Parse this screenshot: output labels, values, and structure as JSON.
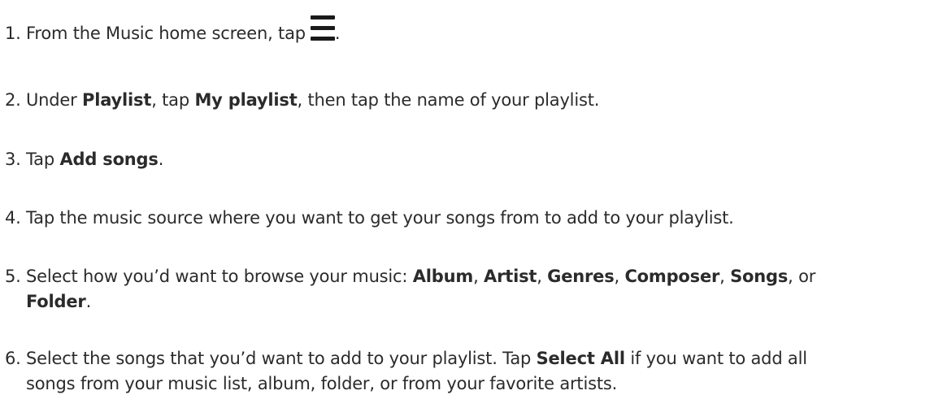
{
  "steps": [
    {
      "num": "1.",
      "text_before": "From the Music home screen, tap",
      "icon": "menu-icon",
      "text_after": "."
    },
    {
      "num": "2.",
      "t1": "Under ",
      "b1": "Playlist",
      "t2": ", tap ",
      "b2": "My playlist",
      "t3": ", then tap the name of your playlist."
    },
    {
      "num": "3.",
      "t1": "Tap ",
      "b1": "Add songs",
      "t2": "."
    },
    {
      "num": "4.",
      "t1": "Tap the music source where you want to get your songs from to add to your playlist."
    },
    {
      "num": "5.",
      "t1": "Select how you’d want to browse your music: ",
      "b1": "Album",
      "t2": ", ",
      "b2": "Artist",
      "t3": ", ",
      "b3": "Genres",
      "t4": ", ",
      "b4": "Composer",
      "t5": ", ",
      "b5": "Songs",
      "t6": ", or",
      "b6": "Folder",
      "t7": "."
    },
    {
      "num": "6.",
      "t1": "Select the songs that you’d want to add to your playlist. Tap ",
      "b1": "Select All",
      "t2": " if you want to add all",
      "t3": "songs from your music list, album, folder, or from your favorite artists."
    }
  ]
}
